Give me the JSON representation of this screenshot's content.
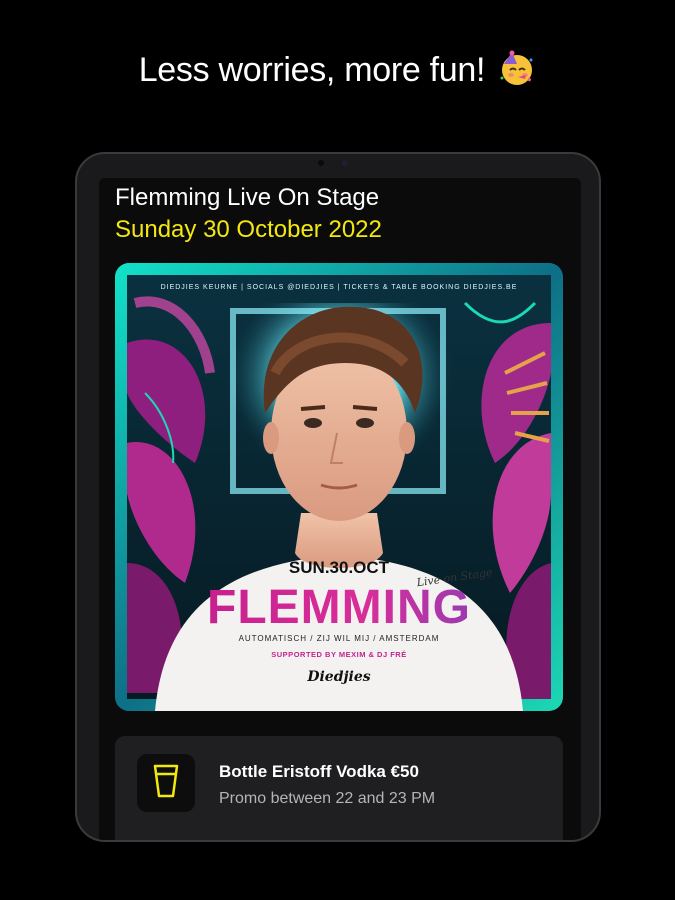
{
  "headline": {
    "text": "Less worries, more fun!",
    "emoji_icon": "partying-face-icon"
  },
  "event": {
    "title": "Flemming Live On Stage",
    "date": "Sunday 30 October 2022"
  },
  "poster": {
    "top_banner": "DIEDJIES KEURNE | SOCIALS @DIEDJIES | TICKETS & TABLE BOOKING DIEDJIES.BE",
    "date_text": "SUN.30.OCT",
    "script_text": "Live on Stage",
    "headliner": "FLEMMING",
    "songs": "AUTOMATISCH / ZIJ WIL MIJ / AMSTERDAM",
    "support": "SUPPORTED BY MEXIM & DJ FRÉ",
    "logo_text": "Diedjies"
  },
  "promo": {
    "icon": "beer-glass-icon",
    "title": "Bottle Eristoff Vodka €50",
    "subtitle": "Promo between 22 and 23 PM"
  },
  "colors": {
    "accent_yellow": "#f2e80f",
    "background": "#000000",
    "card": "#1f1f21",
    "poster_magenta": "#c2238f",
    "poster_teal": "#14d9c2"
  }
}
